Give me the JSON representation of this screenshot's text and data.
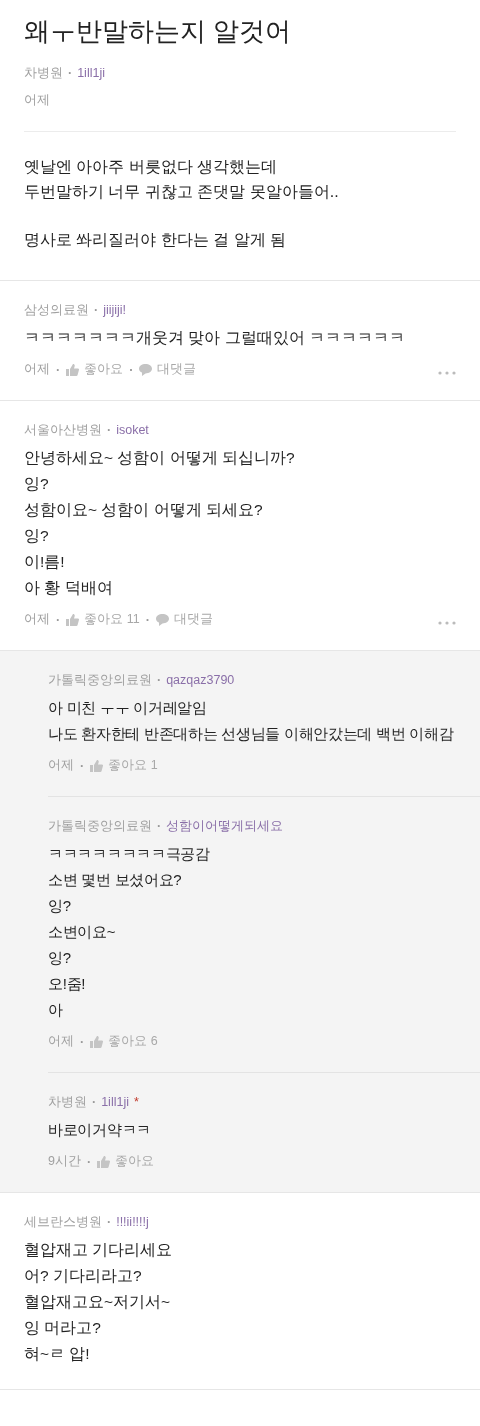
{
  "post": {
    "title": "왜ㅜ반말하는지 알것어",
    "hospital": "차병원",
    "dot": "·",
    "author": "1ill1ji",
    "date": "어제",
    "paragraphs": [
      "옛날엔 아아주 버릇없다 생각했는데\n두번말하기 너무 귀찮고 존댓말 못알아들어..",
      "명사로 쏴리질러야 한다는 걸 알게 됨"
    ]
  },
  "comments": [
    {
      "hospital": "삼성의료원",
      "dot": "·",
      "author": "jiijiji!",
      "text": "ㅋㅋㅋㅋㅋㅋㅋ개웃겨 맞아 그럴때있어 ㅋㅋㅋㅋㅋㅋ",
      "time": "어제",
      "like": "좋아요",
      "reply": "대댓글",
      "menu": true
    },
    {
      "hospital": "서울아산병원",
      "dot": "·",
      "author": "isoket",
      "text": "안녕하세요~ 성함이 어떻게 되십니까?\n잉?\n성함이요~ 성함이 어떻게 되세요?\n잉?\n이!름!\n아 황 덕배여",
      "time": "어제",
      "like": "좋아요 11",
      "reply": "대댓글",
      "menu": true,
      "children": [
        {
          "hospital": "가톨릭중앙의료원",
          "dot": "·",
          "author": "qazqaz3790",
          "text": "아 미친 ㅜㅜ 이거레알임\n나도 환자한테 반존대하는 선생님들 이해안갔는데 백번 이해감",
          "time": "어제",
          "like": "좋아요 1"
        },
        {
          "hospital": "가톨릭중앙의료원",
          "dot": "·",
          "author": "성함이어떻게되세요",
          "text": "ㅋㅋㅋㅋㅋㅋㅋㅋ극공감\n소변 몇번 보셨어요?\n잉?\n소변이요~\n잉?\n오!줌!\n아",
          "time": "어제",
          "like": "좋아요 6"
        },
        {
          "hospital": "차병원",
          "dot": "·",
          "author": "1ill1ji",
          "badge": "*",
          "text": "바로이거약ㅋㅋ",
          "time": "9시간",
          "like": "좋아요"
        }
      ]
    },
    {
      "hospital": "세브란스병원",
      "dot": "·",
      "author": "!!!ii!!!!j",
      "text": "혈압재고 기다리세요\n어? 기다리라고?\n혈압재고요~저기서~\n잉 머라고?\n혀~ㄹ 압!",
      "menu": false
    }
  ]
}
